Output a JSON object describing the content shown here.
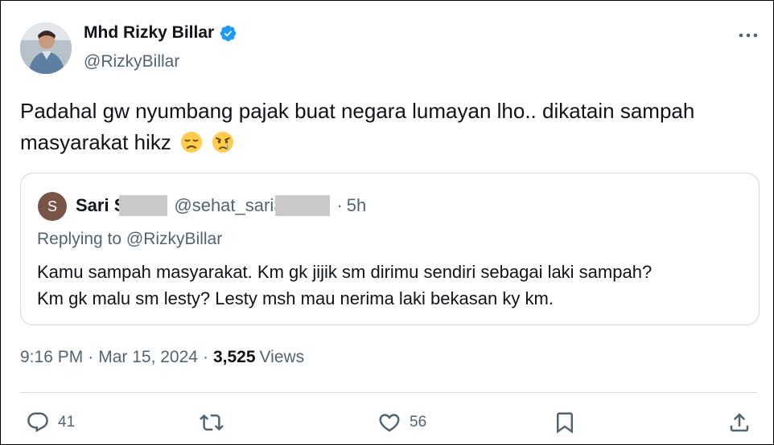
{
  "author": {
    "name": "Mhd Rizky Billar",
    "handle": "@RizkyBillar",
    "verified": true
  },
  "tweet": {
    "text_line1": "Padahal gw nyumbang pajak buat negara lumayan lho.. dikatain sampah",
    "text_line2": "masyarakat hikz",
    "emojis": [
      "disappointed-face-icon",
      "crying-face-icon"
    ]
  },
  "quoted": {
    "avatar_letter": "S",
    "name": "Sari S",
    "handle": "@sehat_sari3",
    "separator": "·",
    "time": "5h",
    "replying_to": "Replying to @RizkyBillar",
    "text_line1": "Kamu sampah masyarakat. Km gk jijik sm dirimu sendiri sebagai laki sampah?",
    "text_line2": "Km gk malu sm lesty? Lesty msh mau nerima laki bekasan ky km."
  },
  "meta": {
    "time": "9:16 PM",
    "date": "Mar 15, 2024",
    "views_count": "3,525",
    "views_label": "Views",
    "separator": "·"
  },
  "actions": {
    "replies": "41",
    "likes": "56"
  },
  "colors": {
    "text": "#0f1419",
    "secondary": "#536471",
    "verified_blue": "#1d9bf0",
    "border": "#cfd9de"
  }
}
